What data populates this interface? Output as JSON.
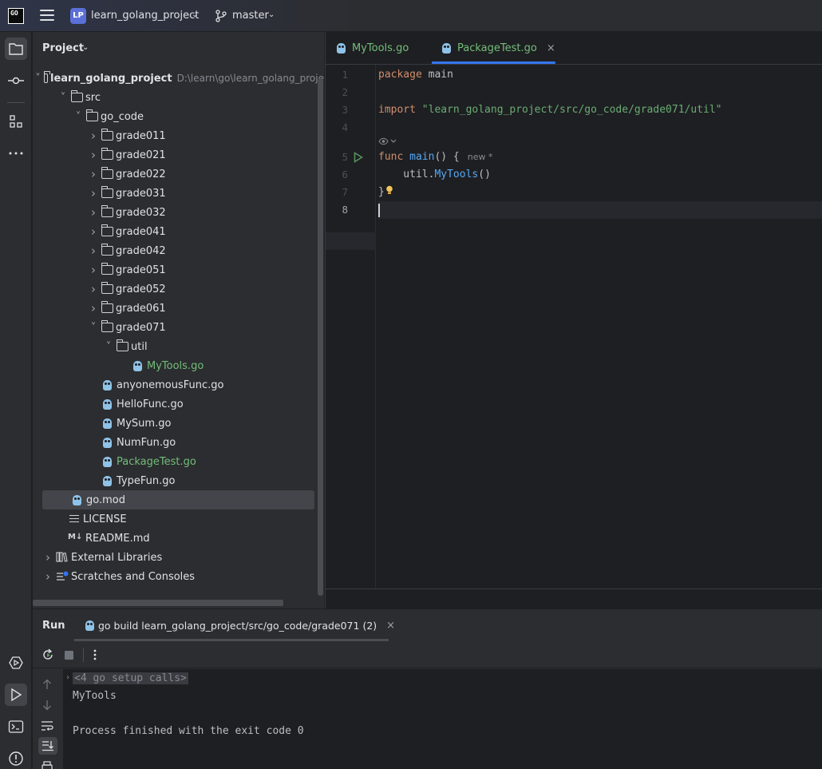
{
  "titlebar": {
    "app_logo": "GO",
    "project_badge": "LP",
    "project_name": "learn_golang_project",
    "branch": "master"
  },
  "left_toolbar": {
    "items": [
      "project-icon",
      "commit-icon",
      "structure-icon",
      "more-icon"
    ],
    "bottom_items": [
      "services-icon",
      "run-icon",
      "terminal-icon",
      "problems-icon"
    ]
  },
  "project_panel": {
    "title": "Project",
    "tree": [
      {
        "label": "learn_golang_project",
        "hint": "D:\\learn\\go\\learn_golang_proje",
        "type": "folder",
        "expanded": true
      },
      {
        "label": "src",
        "type": "folder",
        "expanded": true
      },
      {
        "label": "go_code",
        "type": "folder",
        "expanded": true
      },
      {
        "label": "grade011",
        "type": "folder"
      },
      {
        "label": "grade021",
        "type": "folder"
      },
      {
        "label": "grade022",
        "type": "folder"
      },
      {
        "label": "grade031",
        "type": "folder"
      },
      {
        "label": "grade032",
        "type": "folder"
      },
      {
        "label": "grade041",
        "type": "folder"
      },
      {
        "label": "grade042",
        "type": "folder"
      },
      {
        "label": "grade051",
        "type": "folder"
      },
      {
        "label": "grade052",
        "type": "folder"
      },
      {
        "label": "grade061",
        "type": "folder"
      },
      {
        "label": "grade071",
        "type": "folder",
        "expanded": true
      },
      {
        "label": "util",
        "type": "folder",
        "expanded": true
      },
      {
        "label": "MyTools.go",
        "type": "go"
      },
      {
        "label": "anyonemousFunc.go",
        "type": "go"
      },
      {
        "label": "HelloFunc.go",
        "type": "go"
      },
      {
        "label": "MySum.go",
        "type": "go"
      },
      {
        "label": "NumFun.go",
        "type": "go"
      },
      {
        "label": "PackageTest.go",
        "type": "go"
      },
      {
        "label": "TypeFun.go",
        "type": "go"
      },
      {
        "label": "go.mod",
        "type": "gomod",
        "selected": true
      },
      {
        "label": "LICENSE",
        "type": "text"
      },
      {
        "label": "README.md",
        "type": "md",
        "icon_text": "M↓"
      },
      {
        "label": "External Libraries",
        "type": "libs"
      },
      {
        "label": "Scratches and Consoles",
        "type": "scratch"
      }
    ]
  },
  "editor": {
    "tabs": [
      {
        "label": "MyTools.go",
        "active": false
      },
      {
        "label": "PackageTest.go",
        "active": true
      }
    ],
    "tab_close": "×",
    "line_numbers": [
      "1",
      "2",
      "3",
      "4",
      "5",
      "6",
      "7",
      "8"
    ],
    "lines": {
      "l1_kw": "package",
      "l1_name": " main",
      "l3_kw": "import",
      "l3_str": " \"learn_golang_project/src/go_code/grade071/util\"",
      "l5_kw": "func",
      "l5_fn": " main",
      "l5_rest": "() {",
      "l5_inlay": "new *",
      "l6_pkg": "    util.",
      "l6_fn": "MyTools",
      "l6_rest": "()",
      "l7": "}"
    }
  },
  "run_panel": {
    "title": "Run",
    "tab_label": "go build learn_golang_project/src/go_code/grade071 (2)",
    "tab_close": "×",
    "console": {
      "folded": "<4 go setup calls>",
      "output": "MyTools",
      "exit": "Process finished with the exit code 0"
    }
  },
  "colors": {
    "accent": "#3574f0",
    "bg": "#1e1f22",
    "panel": "#2b2d30",
    "keyword": "#cf8e6d",
    "function": "#56a8f5",
    "string": "#6aab73",
    "modified_file": "#73bd79"
  }
}
